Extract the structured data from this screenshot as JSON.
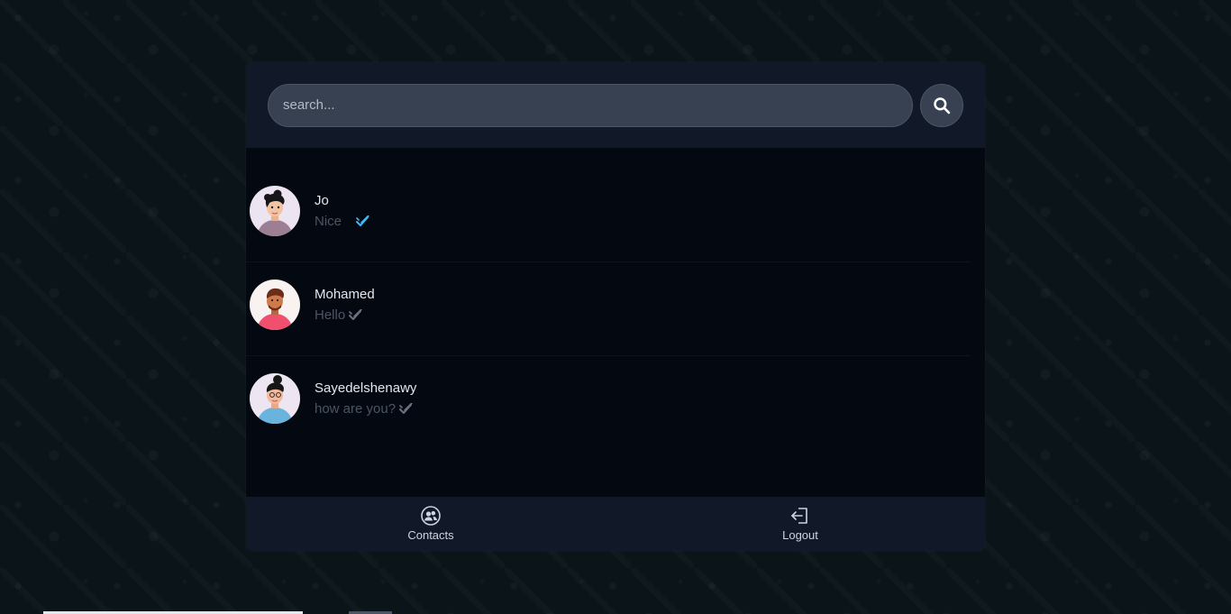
{
  "search": {
    "placeholder": "search...",
    "value": ""
  },
  "icons": {
    "search": "search-icon",
    "read": "double-check-icon",
    "contacts": "contacts-icon",
    "logout": "logout-icon"
  },
  "colors": {
    "read_check": "#38bdf8",
    "sent_check": "#6b7280"
  },
  "chats": [
    {
      "name": "Jo",
      "last_message": "Nice",
      "status": "read"
    },
    {
      "name": "Mohamed",
      "last_message": "Hello",
      "status": "delivered"
    },
    {
      "name": "Sayedelshenawy",
      "last_message": "how are you?",
      "status": "delivered"
    }
  ],
  "nav": {
    "contacts_label": "Contacts",
    "logout_label": "Logout"
  }
}
